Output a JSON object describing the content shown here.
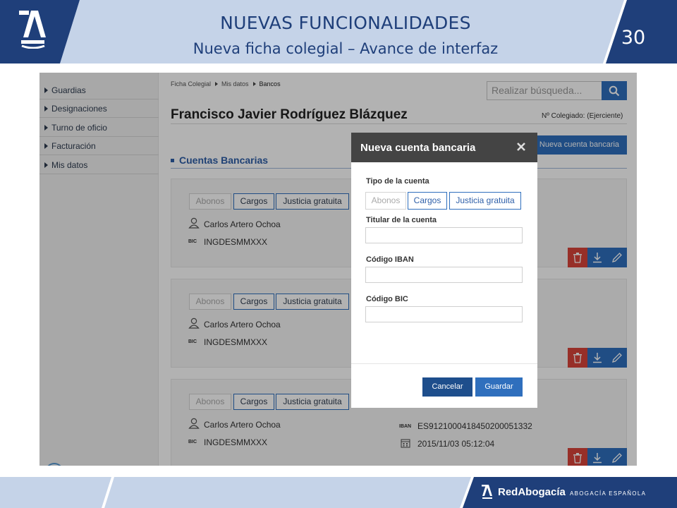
{
  "slide": {
    "title": "NUEVAS FUNCIONALIDADES",
    "subtitle": "Nueva ficha colegial – Avance de interfaz",
    "page_number": "30",
    "footer_brand": "RedAbogacía",
    "footer_sub": "ABOGACÍA ESPAÑOLA",
    "colors": {
      "navy": "#1f3f7a",
      "light_band": "#c5d3e8",
      "accent": "#2f6fbd",
      "danger": "#d9443a"
    }
  },
  "sidebar": {
    "items": [
      {
        "label": "Guardias"
      },
      {
        "label": "Designaciones"
      },
      {
        "label": "Turno de oficio"
      },
      {
        "label": "Facturación"
      },
      {
        "label": "Mis datos"
      }
    ]
  },
  "breadcrumb": {
    "items": [
      "Ficha Colegial",
      "Mis datos",
      "Bancos"
    ]
  },
  "search": {
    "placeholder": "Realizar búsqueda...",
    "icon": "search-icon"
  },
  "profile": {
    "name": "Francisco Javier Rodríguez Blázquez",
    "colegiado": "Nº Colegiado: (Ejerciente)"
  },
  "new_account_button": "Nueva cuenta bancaria",
  "section_title": "Cuentas Bancarias",
  "account_tabs": [
    "Abonos",
    "Cargos",
    "Justicia gratuita"
  ],
  "cards": [
    {
      "owner": "Carlos Artero Ochoa",
      "bic_label": "BIC",
      "bic": "INGDESMMXXX"
    },
    {
      "owner": "Carlos Artero Ochoa",
      "bic_label": "BIC",
      "bic": "INGDESMMXXX"
    },
    {
      "owner": "Carlos Artero Ochoa",
      "bic_label": "BIC",
      "bic": "INGDESMMXXX",
      "iban_label": "IBAN",
      "iban": "ES9121000418450200051332",
      "date": "2015/11/03 05:12:04"
    }
  ],
  "modal": {
    "title": "Nueva cuenta bancaria",
    "close_icon": "close-icon",
    "type_label": "Tipo de la cuenta",
    "tabs": [
      "Abonos",
      "Cargos",
      "Justicia gratuita"
    ],
    "owner_label": "Titular de la cuenta",
    "owner_value": "",
    "iban_label": "Código IBAN",
    "iban_value": "",
    "bic_label": "Código BIC",
    "bic_value": "",
    "cancel": "Cancelar",
    "save": "Guardar"
  }
}
